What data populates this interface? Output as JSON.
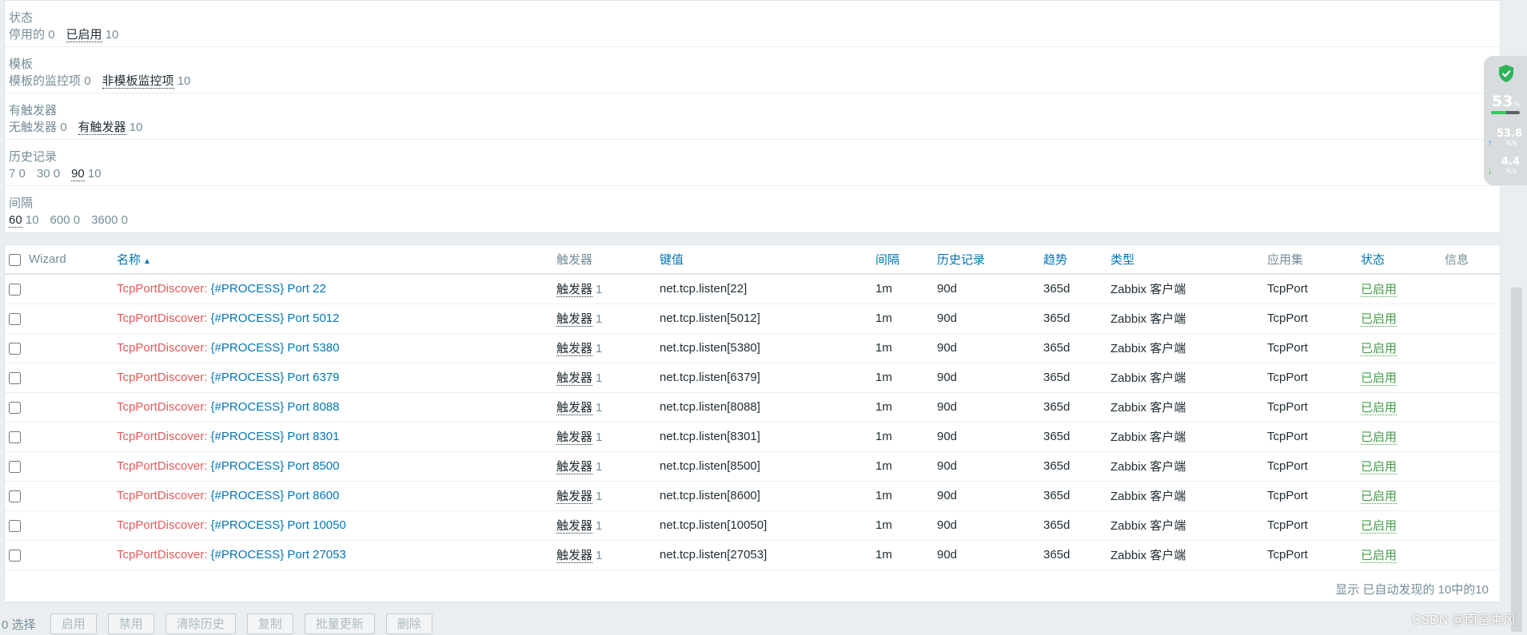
{
  "filters": [
    {
      "title": "状态",
      "options": [
        {
          "label": "停用的",
          "count": "0",
          "selected": false
        },
        {
          "label": "已启用",
          "count": "10",
          "selected": true
        }
      ]
    },
    {
      "title": "模板",
      "options": [
        {
          "label": "模板的监控项",
          "count": "0",
          "selected": false
        },
        {
          "label": "非模板监控项",
          "count": "10",
          "selected": true
        }
      ]
    },
    {
      "title": "有触发器",
      "options": [
        {
          "label": "无触发器",
          "count": "0",
          "selected": false
        },
        {
          "label": "有触发器",
          "count": "10",
          "selected": true
        }
      ]
    },
    {
      "title": "历史记录",
      "options": [
        {
          "label": "7",
          "count": "0",
          "selected": false
        },
        {
          "label": "30",
          "count": "0",
          "selected": false
        },
        {
          "label": "90",
          "count": "10",
          "selected": true
        }
      ]
    },
    {
      "title": "间隔",
      "options": [
        {
          "label": "60",
          "count": "10",
          "selected": true
        },
        {
          "label": "600",
          "count": "0",
          "selected": false
        },
        {
          "label": "3600",
          "count": "0",
          "selected": false
        }
      ]
    }
  ],
  "table": {
    "headers": {
      "wizard": "Wizard",
      "name": "名称",
      "triggers": "触发器",
      "key": "键值",
      "interval": "间隔",
      "history": "历史记录",
      "trends": "趋势",
      "type": "类型",
      "application": "应用集",
      "status": "状态",
      "info": "信息"
    },
    "rows": [
      {
        "template": "TcpPortDiscover",
        "name": "{#PROCESS} Port 22",
        "trigger_label": "触发器",
        "trigger_count": "1",
        "key": "net.tcp.listen[22]",
        "interval": "1m",
        "history": "90d",
        "trends": "365d",
        "type": "Zabbix 客户端",
        "application": "TcpPort",
        "status": "已启用"
      },
      {
        "template": "TcpPortDiscover",
        "name": "{#PROCESS} Port 5012",
        "trigger_label": "触发器",
        "trigger_count": "1",
        "key": "net.tcp.listen[5012]",
        "interval": "1m",
        "history": "90d",
        "trends": "365d",
        "type": "Zabbix 客户端",
        "application": "TcpPort",
        "status": "已启用"
      },
      {
        "template": "TcpPortDiscover",
        "name": "{#PROCESS} Port 5380",
        "trigger_label": "触发器",
        "trigger_count": "1",
        "key": "net.tcp.listen[5380]",
        "interval": "1m",
        "history": "90d",
        "trends": "365d",
        "type": "Zabbix 客户端",
        "application": "TcpPort",
        "status": "已启用"
      },
      {
        "template": "TcpPortDiscover",
        "name": "{#PROCESS} Port 6379",
        "trigger_label": "触发器",
        "trigger_count": "1",
        "key": "net.tcp.listen[6379]",
        "interval": "1m",
        "history": "90d",
        "trends": "365d",
        "type": "Zabbix 客户端",
        "application": "TcpPort",
        "status": "已启用"
      },
      {
        "template": "TcpPortDiscover",
        "name": "{#PROCESS} Port 8088",
        "trigger_label": "触发器",
        "trigger_count": "1",
        "key": "net.tcp.listen[8088]",
        "interval": "1m",
        "history": "90d",
        "trends": "365d",
        "type": "Zabbix 客户端",
        "application": "TcpPort",
        "status": "已启用"
      },
      {
        "template": "TcpPortDiscover",
        "name": "{#PROCESS} Port 8301",
        "trigger_label": "触发器",
        "trigger_count": "1",
        "key": "net.tcp.listen[8301]",
        "interval": "1m",
        "history": "90d",
        "trends": "365d",
        "type": "Zabbix 客户端",
        "application": "TcpPort",
        "status": "已启用"
      },
      {
        "template": "TcpPortDiscover",
        "name": "{#PROCESS} Port 8500",
        "trigger_label": "触发器",
        "trigger_count": "1",
        "key": "net.tcp.listen[8500]",
        "interval": "1m",
        "history": "90d",
        "trends": "365d",
        "type": "Zabbix 客户端",
        "application": "TcpPort",
        "status": "已启用"
      },
      {
        "template": "TcpPortDiscover",
        "name": "{#PROCESS} Port 8600",
        "trigger_label": "触发器",
        "trigger_count": "1",
        "key": "net.tcp.listen[8600]",
        "interval": "1m",
        "history": "90d",
        "trends": "365d",
        "type": "Zabbix 客户端",
        "application": "TcpPort",
        "status": "已启用"
      },
      {
        "template": "TcpPortDiscover",
        "name": "{#PROCESS} Port 10050",
        "trigger_label": "触发器",
        "trigger_count": "1",
        "key": "net.tcp.listen[10050]",
        "interval": "1m",
        "history": "90d",
        "trends": "365d",
        "type": "Zabbix 客户端",
        "application": "TcpPort",
        "status": "已启用"
      },
      {
        "template": "TcpPortDiscover",
        "name": "{#PROCESS} Port 27053",
        "trigger_label": "触发器",
        "trigger_count": "1",
        "key": "net.tcp.listen[27053]",
        "interval": "1m",
        "history": "90d",
        "trends": "365d",
        "type": "Zabbix 客户端",
        "application": "TcpPort",
        "status": "已启用"
      }
    ],
    "footer": "显示 已自动发现的 10中的10"
  },
  "actions": {
    "selected_count": "0 选择",
    "buttons": [
      "启用",
      "禁用",
      "清除历史",
      "复制",
      "批量更新",
      "删除"
    ]
  },
  "monitor": {
    "percent": "53",
    "percent_unit": "%",
    "percent_fraction": 0.53,
    "upload": "53.8",
    "download": "4.4",
    "speed_unit": "K/s",
    "shield_color": "#2fb35a"
  },
  "watermark": "CSDN @南宫乘风",
  "colors": {
    "link": "#0275b8",
    "template": "#e45959",
    "enabled": "#429e47"
  }
}
